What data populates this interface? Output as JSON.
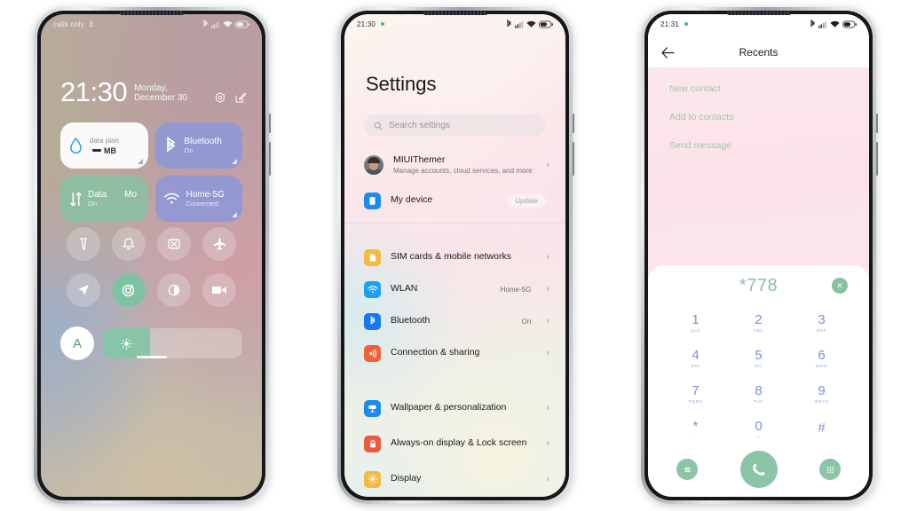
{
  "phone1": {
    "name": "control-center",
    "statusbar": {
      "left_text": "calls only",
      "secondary_text": "E",
      "battery_text": "39"
    },
    "clock": {
      "time": "21:30",
      "date": "Monday, December 30"
    },
    "tiles": [
      {
        "id": "data-plan",
        "title": "data plan",
        "value": "MB",
        "style": "white"
      },
      {
        "id": "bluetooth",
        "title": "Bluetooth",
        "sub": "On",
        "style": "blue"
      },
      {
        "id": "mobile-data",
        "title": "Data",
        "title2": "Mo",
        "sub": "On",
        "style": "green"
      },
      {
        "id": "wlan",
        "title": "Home-5G",
        "sub": "Connected",
        "style": "blue"
      }
    ],
    "toggles": [
      {
        "id": "flashlight",
        "on": false
      },
      {
        "id": "silent",
        "on": false
      },
      {
        "id": "screenshot",
        "on": false
      },
      {
        "id": "airplane-mode",
        "on": false
      },
      {
        "id": "location",
        "on": false
      },
      {
        "id": "auto-rotate",
        "on": true
      },
      {
        "id": "dark-mode",
        "on": false
      },
      {
        "id": "screen-recorder",
        "on": false
      }
    ],
    "brightness": {
      "auto_label": "A",
      "fill_percent": 34
    }
  },
  "phone2": {
    "name": "settings",
    "statusbar": {
      "time": "21:30",
      "battery_text": "39"
    },
    "title": "Settings",
    "search_placeholder": "Search settings",
    "account": {
      "name": "MIUIThemer",
      "subtitle": "Manage accounts, cloud services, and more"
    },
    "device": {
      "label": "My device",
      "badge": "Update"
    },
    "groups": [
      {
        "items": [
          {
            "label": "SIM cards & mobile networks",
            "value": "",
            "icon": "sim-icon",
            "color": "#f5b93f"
          },
          {
            "label": "WLAN",
            "value": "Home-5G",
            "icon": "wifi-icon",
            "color": "#1ca0f2"
          },
          {
            "label": "Bluetooth",
            "value": "On",
            "icon": "bluetooth-icon",
            "color": "#1877f2"
          },
          {
            "label": "Connection & sharing",
            "value": "",
            "icon": "share-icon",
            "color": "#f0603c"
          }
        ]
      },
      {
        "items": [
          {
            "label": "Wallpaper & personalization",
            "value": "",
            "icon": "wallpaper-icon",
            "color": "#1a8cf0"
          },
          {
            "label": "Always-on display & Lock screen",
            "value": "",
            "icon": "lock-icon",
            "color": "#f05a3c"
          },
          {
            "label": "Display",
            "value": "",
            "icon": "brightness-icon",
            "color": "#f5b93f"
          }
        ]
      }
    ]
  },
  "phone3": {
    "name": "dialer",
    "statusbar": {
      "time": "21:31",
      "battery_text": "39"
    },
    "nav_title": "Recents",
    "menu_items": [
      "New contact",
      "Add to contacts",
      "Send message"
    ],
    "dialed_number": "*778",
    "keys": [
      {
        "digit": "1",
        "letters": "QLD"
      },
      {
        "digit": "2",
        "letters": "ABC"
      },
      {
        "digit": "3",
        "letters": "DEF"
      },
      {
        "digit": "4",
        "letters": "GHI"
      },
      {
        "digit": "5",
        "letters": "JKL"
      },
      {
        "digit": "6",
        "letters": "MNO"
      },
      {
        "digit": "7",
        "letters": "PQRS"
      },
      {
        "digit": "8",
        "letters": "TUV"
      },
      {
        "digit": "9",
        "letters": "WXYZ"
      },
      {
        "digit": "*",
        "letters": ","
      },
      {
        "digit": "0",
        "letters": "+"
      },
      {
        "digit": "#",
        "letters": ""
      }
    ]
  },
  "colors": {
    "accent_green": "#8cc4a7",
    "dial_blue": "#7d8fd6",
    "tile_blue": "#8296e2",
    "tile_green": "#83c4a3"
  }
}
